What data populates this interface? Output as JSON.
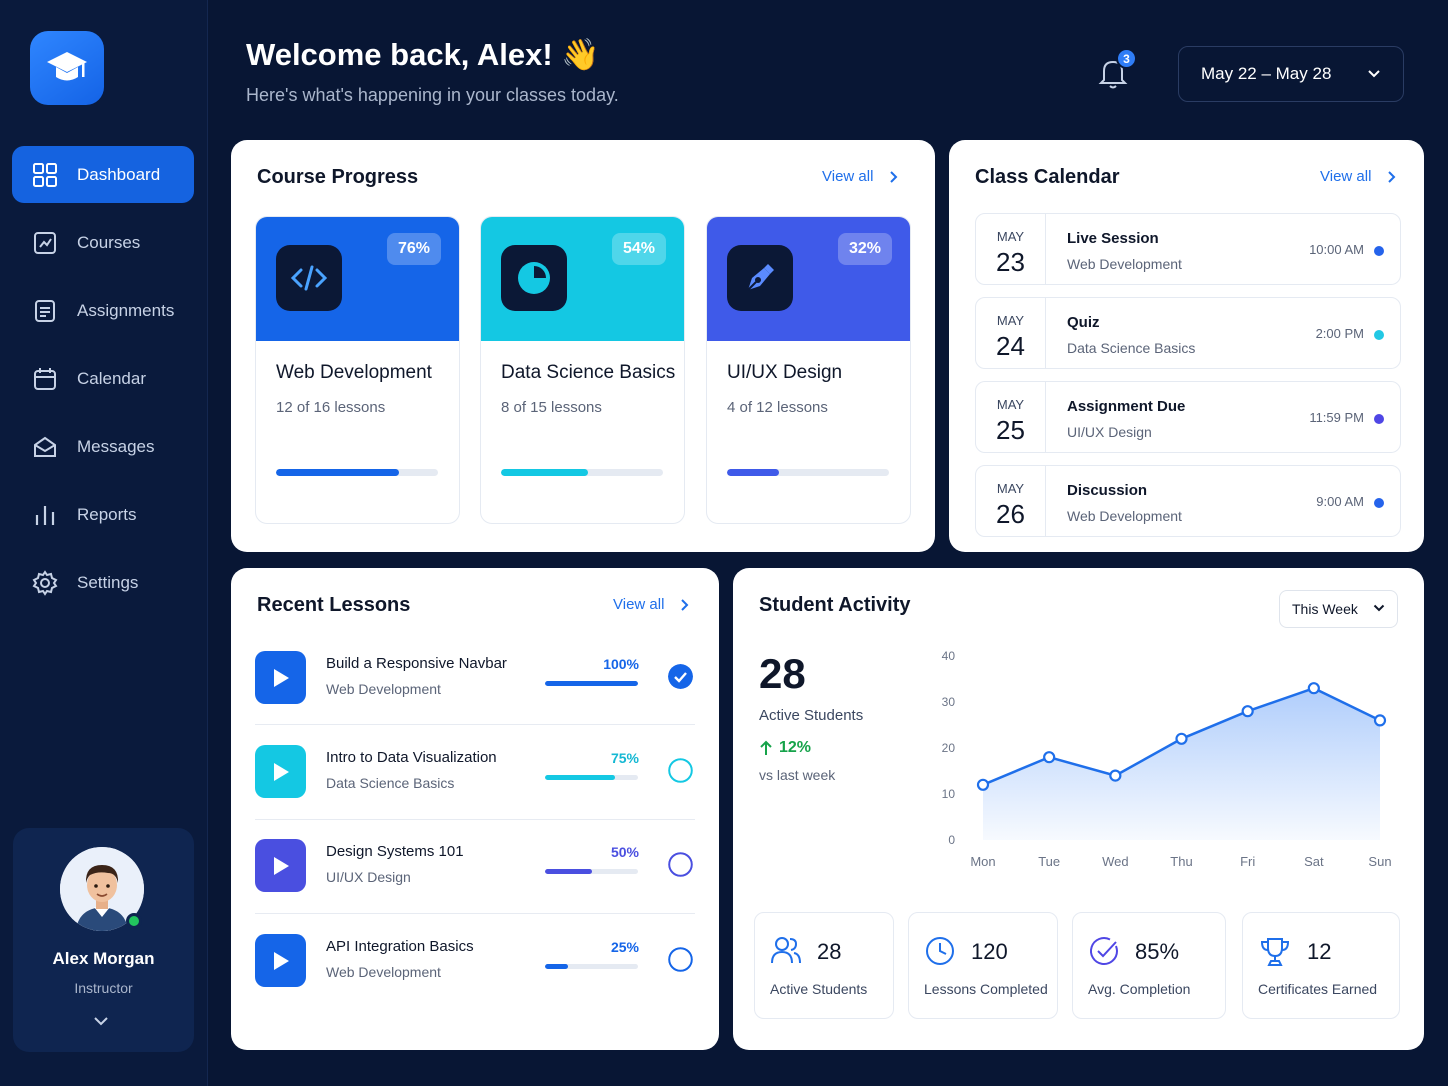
{
  "nav": [
    {
      "label": "Dashboard",
      "icon": "grid-icon",
      "active": true
    },
    {
      "label": "Courses",
      "icon": "courses-icon"
    },
    {
      "label": "Assignments",
      "icon": "assignments-icon"
    },
    {
      "label": "Calendar",
      "icon": "calendar-icon"
    },
    {
      "label": "Messages",
      "icon": "mail-icon"
    },
    {
      "label": "Reports",
      "icon": "bar-chart-icon"
    },
    {
      "label": "Settings",
      "icon": "gear-icon"
    }
  ],
  "profile": {
    "name": "Alex Morgan",
    "role": "Instructor"
  },
  "header": {
    "welcome": "Welcome back, Alex! 👋",
    "subtitle": "Here's what's happening in your classes today.",
    "notifications": "3",
    "date_range": "May 22 – May 28"
  },
  "course_progress": {
    "title": "Course Progress",
    "view_all": "View all",
    "courses": [
      {
        "name": "Web Development",
        "lessons": "12 of 16 lessons",
        "percent_label": "76%",
        "progress": 76,
        "color": "#1565e8",
        "icon": "code-icon"
      },
      {
        "name": "Data Science Basics",
        "lessons": "8 of 15 lessons",
        "percent_label": "54%",
        "progress": 54,
        "color": "#14c8e3",
        "icon": "pie-chart-icon"
      },
      {
        "name": "UI/UX Design",
        "lessons": "4 of 12 lessons",
        "percent_label": "32%",
        "progress": 32,
        "color": "#3f5ae9",
        "icon": "pen-tool-icon"
      }
    ]
  },
  "calendar": {
    "title": "Class Calendar",
    "view_all": "View all",
    "events": [
      {
        "month": "MAY",
        "day": "23",
        "title": "Live Session",
        "course": "Web Development",
        "time": "10:00 AM",
        "dot": "#2563eb"
      },
      {
        "month": "MAY",
        "day": "24",
        "title": "Quiz",
        "course": "Data Science Basics",
        "time": "2:00 PM",
        "dot": "#22c8e4"
      },
      {
        "month": "MAY",
        "day": "25",
        "title": "Assignment Due",
        "course": "UI/UX Design",
        "time": "11:59 PM",
        "dot": "#4f46e5"
      },
      {
        "month": "MAY",
        "day": "26",
        "title": "Discussion",
        "course": "Web Development",
        "time": "9:00 AM",
        "dot": "#2563eb"
      }
    ]
  },
  "recent_lessons": {
    "title": "Recent Lessons",
    "view_all": "View all",
    "lessons": [
      {
        "title": "Build a Responsive Navbar",
        "course": "Web Development",
        "percent_label": "100%",
        "progress": 100,
        "color": "#1565e8",
        "complete": true
      },
      {
        "title": "Intro to Data Visualization",
        "course": "Data Science Basics",
        "percent_label": "75%",
        "progress": 75,
        "color": "#14c8e3",
        "complete": false
      },
      {
        "title": "Design Systems 101",
        "course": "UI/UX Design",
        "percent_label": "50%",
        "progress": 50,
        "color": "#4a4fe0",
        "complete": false
      },
      {
        "title": "API Integration Basics",
        "course": "Web Development",
        "percent_label": "25%",
        "progress": 25,
        "color": "#1565e8",
        "complete": false
      }
    ]
  },
  "activity": {
    "title": "Student Activity",
    "period": "This Week",
    "active_count": "28",
    "active_label": "Active Students",
    "trend": "12%",
    "trend_note": "vs last week",
    "stats": [
      {
        "value": "28",
        "label": "Active Students",
        "icon": "users-icon"
      },
      {
        "value": "120",
        "label": "Lessons Completed",
        "icon": "clock-icon"
      },
      {
        "value": "85%",
        "label": "Avg. Completion",
        "icon": "check-circle-icon"
      },
      {
        "value": "12",
        "label": "Certificates Earned",
        "icon": "trophy-icon"
      }
    ]
  },
  "chart_data": {
    "type": "area",
    "categories": [
      "Mon",
      "Tue",
      "Wed",
      "Thu",
      "Fri",
      "Sat",
      "Sun"
    ],
    "values": [
      12,
      18,
      14,
      22,
      28,
      33,
      26
    ],
    "ylim": [
      0,
      40
    ],
    "yticks": [
      0,
      10,
      20,
      30,
      40
    ],
    "grid": false,
    "color": "#1f6fea"
  }
}
